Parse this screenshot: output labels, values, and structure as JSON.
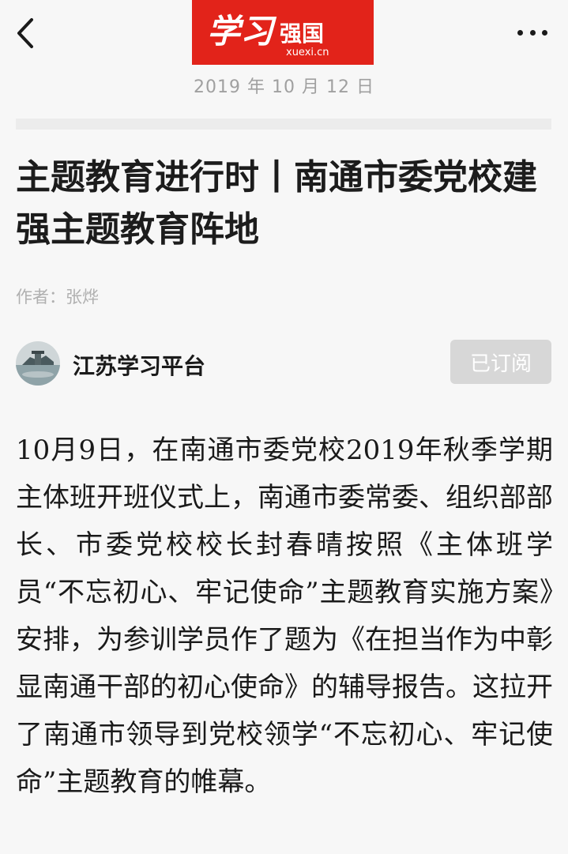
{
  "header": {
    "logo_text": "学习强国",
    "logo_domain": "xuexi.cn",
    "brand_color": "#e2231a"
  },
  "article": {
    "date": "2019 年 10 月 12 日",
    "title": "主题教育进行时丨南通市委党校建强主题教育阵地",
    "author": "作者：张烨",
    "source_name": "江苏学习平台",
    "subscribe_label": "已订阅",
    "body": "10月9日，在南通市委党校2019年秋季学期主体班开班仪式上，南通市委常委、组织部部长、市委党校校长封春晴按照《主体班学员“不忘初心、牢记使命”主题教育实施方案》安排，为参训学员作了题为《在担当作为中彰显南通干部的初心使命》的辅导报告。这拉开了南通市领导到党校领学“不忘初心、牢记使命”主题教育的帷幕。"
  },
  "icons": {
    "back": "back-arrow-icon",
    "more": "more-dots-icon"
  }
}
